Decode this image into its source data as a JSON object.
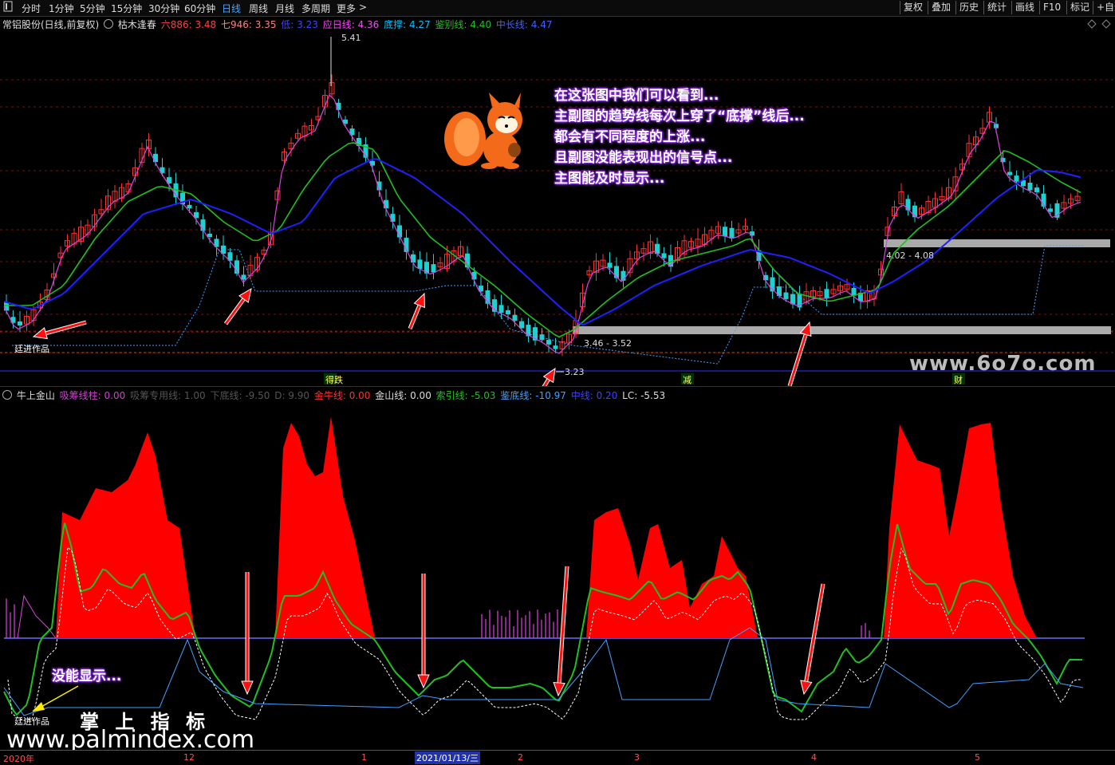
{
  "toolbar": {
    "menu_icon": "menu-icon",
    "periods": [
      "分时",
      "1分钟",
      "5分钟",
      "15分钟",
      "30分钟",
      "60分钟",
      "日线",
      "周线",
      "月线",
      "多周期",
      "更多"
    ],
    "active_period": "日线",
    "more_arrow": ">",
    "right_buttons": [
      "复权",
      "叠加",
      "历史",
      "统计",
      "画线",
      "F10",
      "标记",
      "+自选"
    ]
  },
  "main_legend": {
    "stock": "常铝股份(日线,前复权)",
    "indicator": "枯木逢春",
    "items": [
      {
        "label": "六886: 3.48",
        "color": "#ff4040"
      },
      {
        "label": "七946: 3.35",
        "color": "#ff8080"
      },
      {
        "label": "低: 3.23",
        "color": "#4040ff"
      },
      {
        "label": "应日线: 4.36",
        "color": "#ff40ff"
      },
      {
        "label": "底撑: 4.27",
        "color": "#00c0ff"
      },
      {
        "label": "鉴别线: 4.40",
        "color": "#20c020"
      },
      {
        "label": "中长线: 4.47",
        "color": "#4060ff"
      }
    ]
  },
  "sub_legend": {
    "indicator": "牛上金山",
    "items": [
      {
        "label": "吸筹线柱: 0.00",
        "color": "#d040d0"
      },
      {
        "label": "吸筹专用线: 1.00",
        "color": "#555555"
      },
      {
        "label": "下底线: -9.50",
        "color": "#555555"
      },
      {
        "label": "D: 9.90",
        "color": "#555555"
      },
      {
        "label": "金牛线: 0.00",
        "color": "#ff3030"
      },
      {
        "label": "金山线: 0.00",
        "color": "#dddddd"
      },
      {
        "label": "索引线: -5.03",
        "color": "#20c020"
      },
      {
        "label": "鉴底线: -10.97",
        "color": "#40a0ff"
      },
      {
        "label": "中线: 0.20",
        "color": "#4040ff"
      },
      {
        "label": "LC: -5.53",
        "color": "#dddddd"
      }
    ]
  },
  "price_labels": {
    "high": "5.41",
    "range1": "4.02 - 4.08",
    "range2": "3.46 - 3.52",
    "low": "3.23"
  },
  "markers": [
    "得跌",
    "减",
    "财"
  ],
  "annotations": {
    "note_lines": [
      "在这张图中我们可以看到...",
      "主副图的趋势线每次上穿了“底撑”线后...",
      "都会有不同程度的上涨...",
      "且副图没能表现出的信号点...",
      "主图能及时显示..."
    ],
    "sub_note": "没能显示...",
    "author_top": "廷进作品",
    "author_bottom": "廷进作品"
  },
  "watermarks": {
    "site1": "www.6o7o.com",
    "site2": "www.palmindex.com",
    "brand": "掌 上 指 标"
  },
  "date_axis": {
    "labels": [
      "2020年",
      "12",
      "1",
      "2",
      "3",
      "4",
      "5"
    ],
    "cursor_date": "2021/01/13/三"
  },
  "colors": {
    "up": "#ff3030",
    "down": "#20d0d0",
    "ma_green": "#20c020",
    "ma_blue": "#2020ff",
    "magenta": "#e040e0",
    "support": "#40a0ff",
    "fill_red": "#ff0000"
  }
}
